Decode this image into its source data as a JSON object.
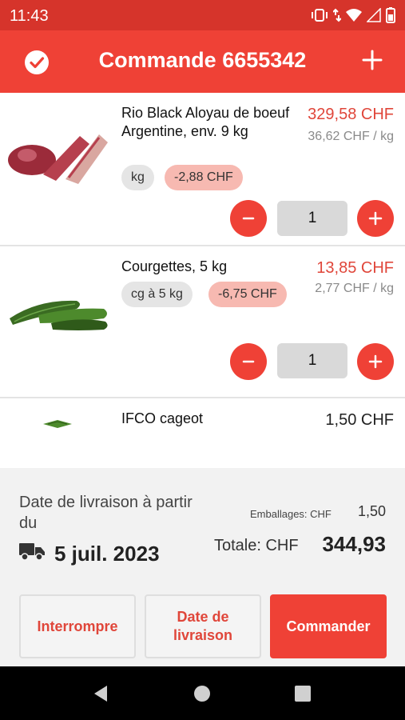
{
  "status_bar": {
    "time": "11:43"
  },
  "header": {
    "title": "Commande 6655342"
  },
  "items": [
    {
      "name": "Rio Black Aloyau de boeuf Argentine, env. 9 kg",
      "price": "329,58 CHF",
      "unit_price": "36,62 CHF / kg",
      "unit_chip": "kg",
      "discount_chip": "-2,88 CHF",
      "quantity": "1"
    },
    {
      "name": "Courgettes, 5 kg",
      "price": "13,85 CHF",
      "unit_price": "2,77 CHF / kg",
      "unit_chip": "cg à 5 kg",
      "discount_chip": "-6,75 CHF",
      "quantity": "1"
    },
    {
      "name": "IFCO cageot",
      "price": "1,50 CHF"
    }
  ],
  "summary": {
    "delivery_label": "Date de livraison à partir du",
    "delivery_date": "5 juil. 2023",
    "packaging_label": "Emballages: CHF",
    "packaging_value": "1,50",
    "total_label": "Totale: CHF",
    "total_value": "344,93"
  },
  "actions": {
    "interrupt": "Interrompre",
    "delivery_date": "Date de livraison",
    "order": "Commander"
  },
  "colors": {
    "accent": "#ef4136",
    "status_bar": "#d6342b"
  }
}
